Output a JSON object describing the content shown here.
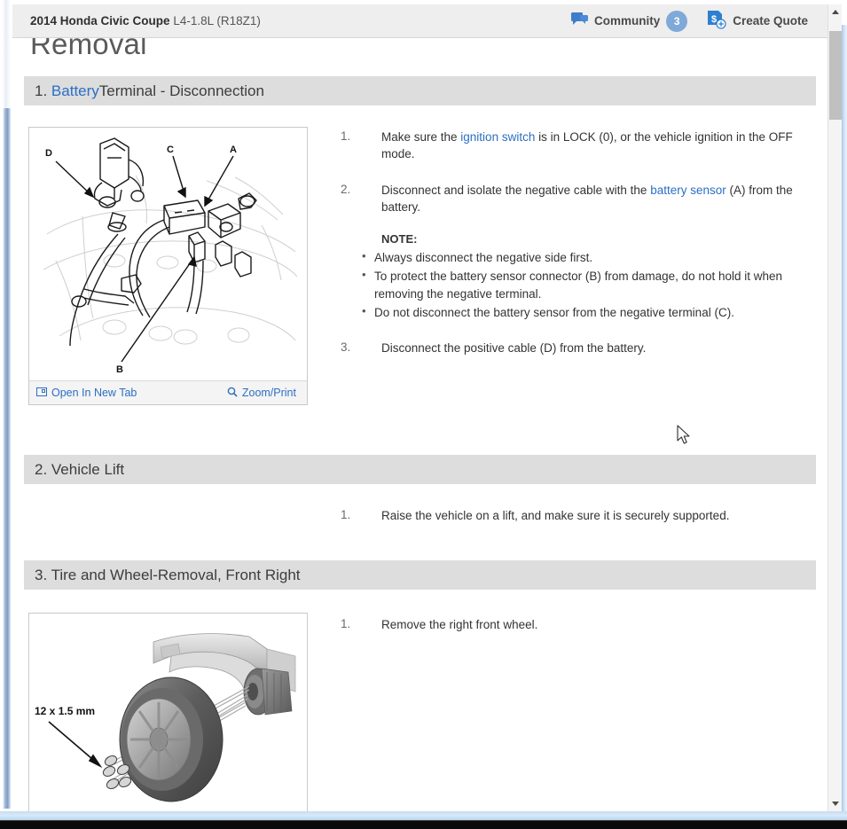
{
  "header": {
    "vehicle_year_make_model": "2014 Honda Civic Coupe",
    "vehicle_engine": "L4-1.8L (R18Z1)",
    "community_label": "Community",
    "community_count": "3",
    "create_quote_label": "Create Quote",
    "community_icon": "comment-bubbles-icon",
    "quote_icon": "dollar-document-add-icon"
  },
  "page": {
    "title": "Removal"
  },
  "sections": [
    {
      "number": "1.",
      "title_link": "Battery",
      "title_rest": " Terminal - Disconnection",
      "figure": {
        "alt": "battery-terminal-diagram",
        "callouts": [
          "A",
          "B",
          "C",
          "D"
        ],
        "open_new_tab_label": "Open In New Tab",
        "open_new_tab_icon": "open-in-new-tab-icon",
        "zoom_print_label": "Zoom/Print",
        "zoom_print_icon": "magnifier-icon"
      },
      "steps": [
        {
          "num": "1.",
          "parts": [
            {
              "t": "Make sure the ",
              "link": false
            },
            {
              "t": "ignition switch",
              "link": true
            },
            {
              "t": " is in LOCK (0), or the vehicle ignition in the OFF mode.",
              "link": false
            }
          ]
        },
        {
          "num": "2.",
          "parts": [
            {
              "t": "Disconnect and isolate the negative cable with the ",
              "link": false
            },
            {
              "t": "battery sensor",
              "link": true
            },
            {
              "t": " (A) from the battery.",
              "link": false
            }
          ]
        }
      ],
      "note": {
        "label": "NOTE:",
        "items": [
          "Always disconnect the negative side first.",
          "To protect the battery sensor connector (B) from damage, do not hold it when removing the negative terminal.",
          "Do not disconnect the battery sensor from the negative terminal (C)."
        ]
      },
      "steps_after_note": [
        {
          "num": "3.",
          "parts": [
            {
              "t": "Disconnect the positive cable (D) from the battery.",
              "link": false
            }
          ]
        }
      ]
    },
    {
      "number": "2.",
      "title_link": "",
      "title_rest": "2. Vehicle Lift",
      "steps": [
        {
          "num": "1.",
          "parts": [
            {
              "t": "Raise the vehicle on a lift, and make sure it is securely supported.",
              "link": false
            }
          ]
        }
      ]
    },
    {
      "number": "3.",
      "title_link": "",
      "title_rest": "3. Tire and Wheel-Removal, Front Right",
      "figure": {
        "alt": "front-wheel-removal-diagram",
        "callout_text": "12 x 1.5 mm"
      },
      "steps": [
        {
          "num": "1.",
          "parts": [
            {
              "t": "Remove the right front wheel.",
              "link": false
            }
          ]
        }
      ]
    }
  ],
  "section_titles": {
    "s1_num": "1.",
    "s1_link": "Battery",
    "s1_rest": " Terminal - Disconnection",
    "s2": "2. Vehicle Lift",
    "s3": "3. Tire and Wheel-Removal, Front Right"
  },
  "figure1_toolbar": {
    "open_new_tab": "Open In New Tab",
    "zoom_print": "Zoom/Print"
  },
  "figure2": {
    "callout": "12 x 1.5 mm"
  },
  "steps_text": {
    "s1_1_a": "Make sure the ",
    "s1_1_link": "ignition switch",
    "s1_1_b": " is in LOCK (0), or the vehicle ignition in the OFF mode.",
    "s1_2_a": "Disconnect and isolate the negative cable with the ",
    "s1_2_link": "battery sensor",
    "s1_2_b": " (A) from the battery.",
    "s1_note_label": "NOTE:",
    "s1_note_1": "Always disconnect the negative side first.",
    "s1_note_2": "To protect the battery sensor connector (B) from damage, do not hold it when removing the negative terminal.",
    "s1_note_3": "Do not disconnect the battery sensor from the negative terminal (C).",
    "s1_3": "Disconnect the positive cable (D) from the battery.",
    "s2_1": "Raise the vehicle on a lift, and make sure it is securely supported.",
    "s3_1": "Remove the right front wheel.",
    "n1": "1.",
    "n2": "2.",
    "n3": "3."
  },
  "colors": {
    "link_blue": "#2b6fc4",
    "section_bar_gray": "#dddddd",
    "header_gray": "#eeeeee",
    "badge_blue": "#7fa9d8"
  }
}
